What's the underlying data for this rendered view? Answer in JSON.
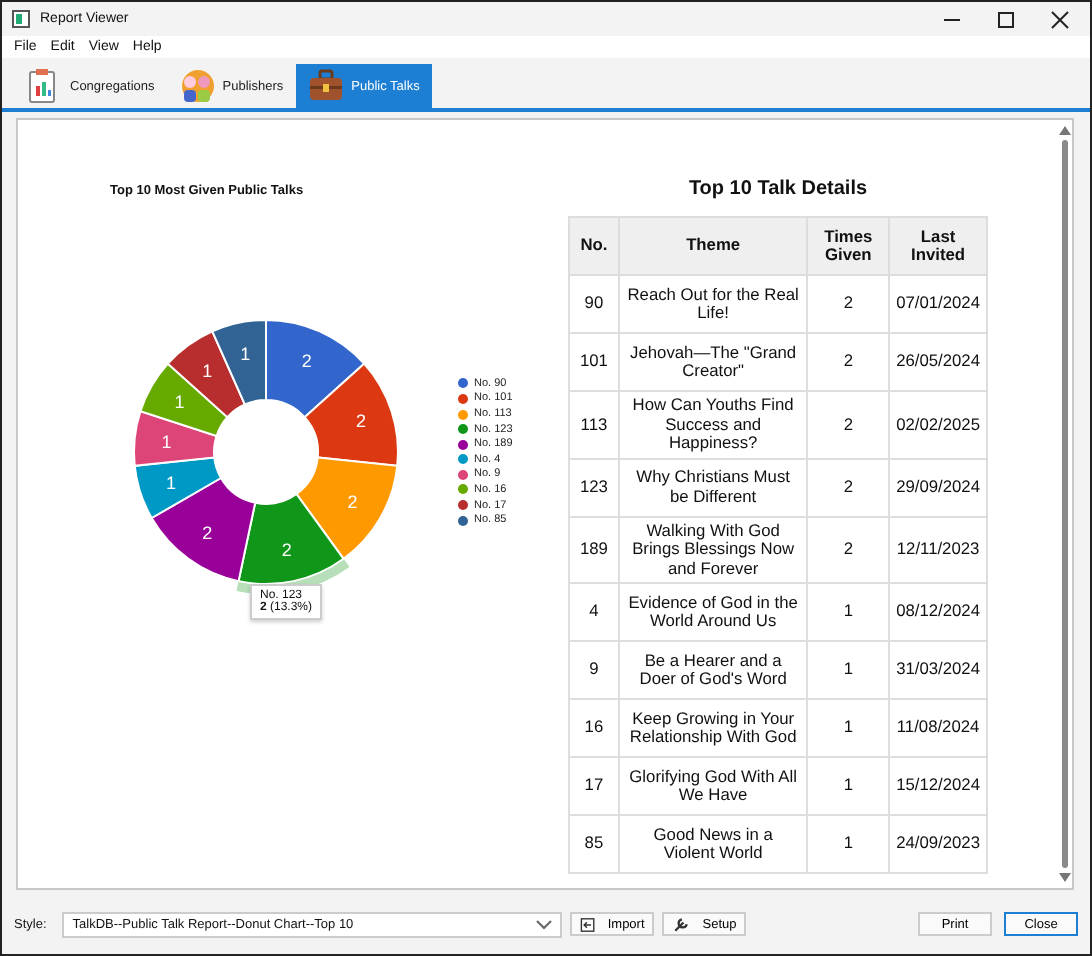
{
  "window": {
    "title": "Report Viewer"
  },
  "menu": [
    "File",
    "Edit",
    "View",
    "Help"
  ],
  "tabs": [
    {
      "label": "Congregations",
      "selected": false,
      "kind": "clipboard"
    },
    {
      "label": "Publishers",
      "selected": false,
      "kind": "people"
    },
    {
      "label": "Public Talks",
      "selected": true,
      "kind": "briefcase"
    }
  ],
  "chart": {
    "title": "Top 10 Most Given Public Talks",
    "chart_data": {
      "type": "donut",
      "categories": [
        "No. 90",
        "No. 101",
        "No. 113",
        "No. 123",
        "No. 189",
        "No. 4",
        "No. 9",
        "No. 16",
        "No. 17",
        "No. 85"
      ],
      "values": [
        2,
        2,
        2,
        2,
        2,
        1,
        1,
        1,
        1,
        1
      ],
      "colors": [
        "#3366cc",
        "#dc3912",
        "#ff9900",
        "#109618",
        "#990099",
        "#0099c6",
        "#dd4477",
        "#66aa00",
        "#b82e2e",
        "#316395"
      ],
      "legend": "right",
      "data_labels": true
    },
    "slices": [
      {
        "selected": false
      },
      {
        "selected": false
      },
      {
        "selected": false
      },
      {
        "selected": true
      },
      {
        "selected": false
      },
      {
        "selected": false
      },
      {
        "selected": false
      },
      {
        "selected": false
      },
      {
        "selected": false
      },
      {
        "selected": false
      }
    ],
    "tooltip": {
      "title": "No. 123",
      "value": "**2** (13.3%)"
    }
  },
  "table": {
    "title": "Top 10 Talk Details",
    "columns": [
      "No.",
      "Theme",
      "Times Given",
      "Last Invited"
    ],
    "rows": [
      [
        "90",
        "Reach Out for the Real Life!",
        "2",
        "07/01/2024"
      ],
      [
        "101",
        "Jehovah—The \"Grand Creator\"",
        "2",
        "26/05/2024"
      ],
      [
        "113",
        "How Can Youths Find Success and Happiness?",
        "2",
        "02/02/2025"
      ],
      [
        "123",
        "Why Christians Must be Different",
        "2",
        "29/09/2024"
      ],
      [
        "189",
        "Walking With God Brings Blessings Now and Forever",
        "2",
        "12/11/2023"
      ],
      [
        "4",
        "Evidence of God in the World Around Us",
        "1",
        "08/12/2024"
      ],
      [
        "9",
        "Be a Hearer and a Doer of God's Word",
        "1",
        "31/03/2024"
      ],
      [
        "16",
        "Keep Growing in Your Relationship With God",
        "1",
        "11/08/2024"
      ],
      [
        "17",
        "Glorifying God With All We Have",
        "1",
        "15/12/2024"
      ],
      [
        "85",
        "Good News in a Violent World",
        "1",
        "24/09/2023"
      ]
    ]
  },
  "footer": {
    "style_label": "Style:",
    "style_value": "TalkDB--Public Talk Report--Donut Chart--Top 10",
    "buttons": [
      {
        "label": "Import",
        "kind": "import"
      },
      {
        "label": "Setup",
        "kind": "setup"
      }
    ],
    "actions": [
      {
        "label": "Print",
        "selected": false
      },
      {
        "label": "Close",
        "selected": true
      }
    ]
  }
}
